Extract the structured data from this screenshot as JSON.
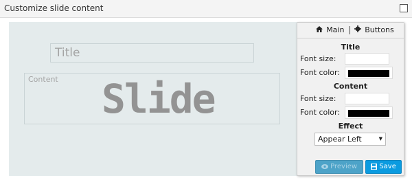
{
  "header": {
    "title": "Customize slide content"
  },
  "canvas": {
    "title_placeholder": "Title",
    "content_label": "Content",
    "slide_text": "Slide"
  },
  "panel": {
    "tabs": [
      {
        "icon": "home-icon",
        "label": "Main"
      },
      {
        "icon": "gear-icon",
        "label": "Buttons"
      }
    ],
    "title_section": {
      "heading": "Title",
      "font_size_label": "Font size:",
      "font_size_value": "",
      "font_color_label": "Font color:",
      "font_color_value": "#000000"
    },
    "content_section": {
      "heading": "Content",
      "font_size_label": "Font size:",
      "font_size_value": "",
      "font_color_label": "Font color:",
      "font_color_value": "#000000"
    },
    "effect": {
      "heading": "Effect",
      "selected": "Appear Left"
    },
    "buttons": {
      "preview_icon": "eye-icon",
      "preview_label": "Preview",
      "save_icon": "floppy-disk-icon",
      "save_label": "Save"
    }
  },
  "colors": {
    "canvas_bg": "#e4ebec",
    "accent": "#0b9be0",
    "accent_disabled": "#4da3c8"
  }
}
